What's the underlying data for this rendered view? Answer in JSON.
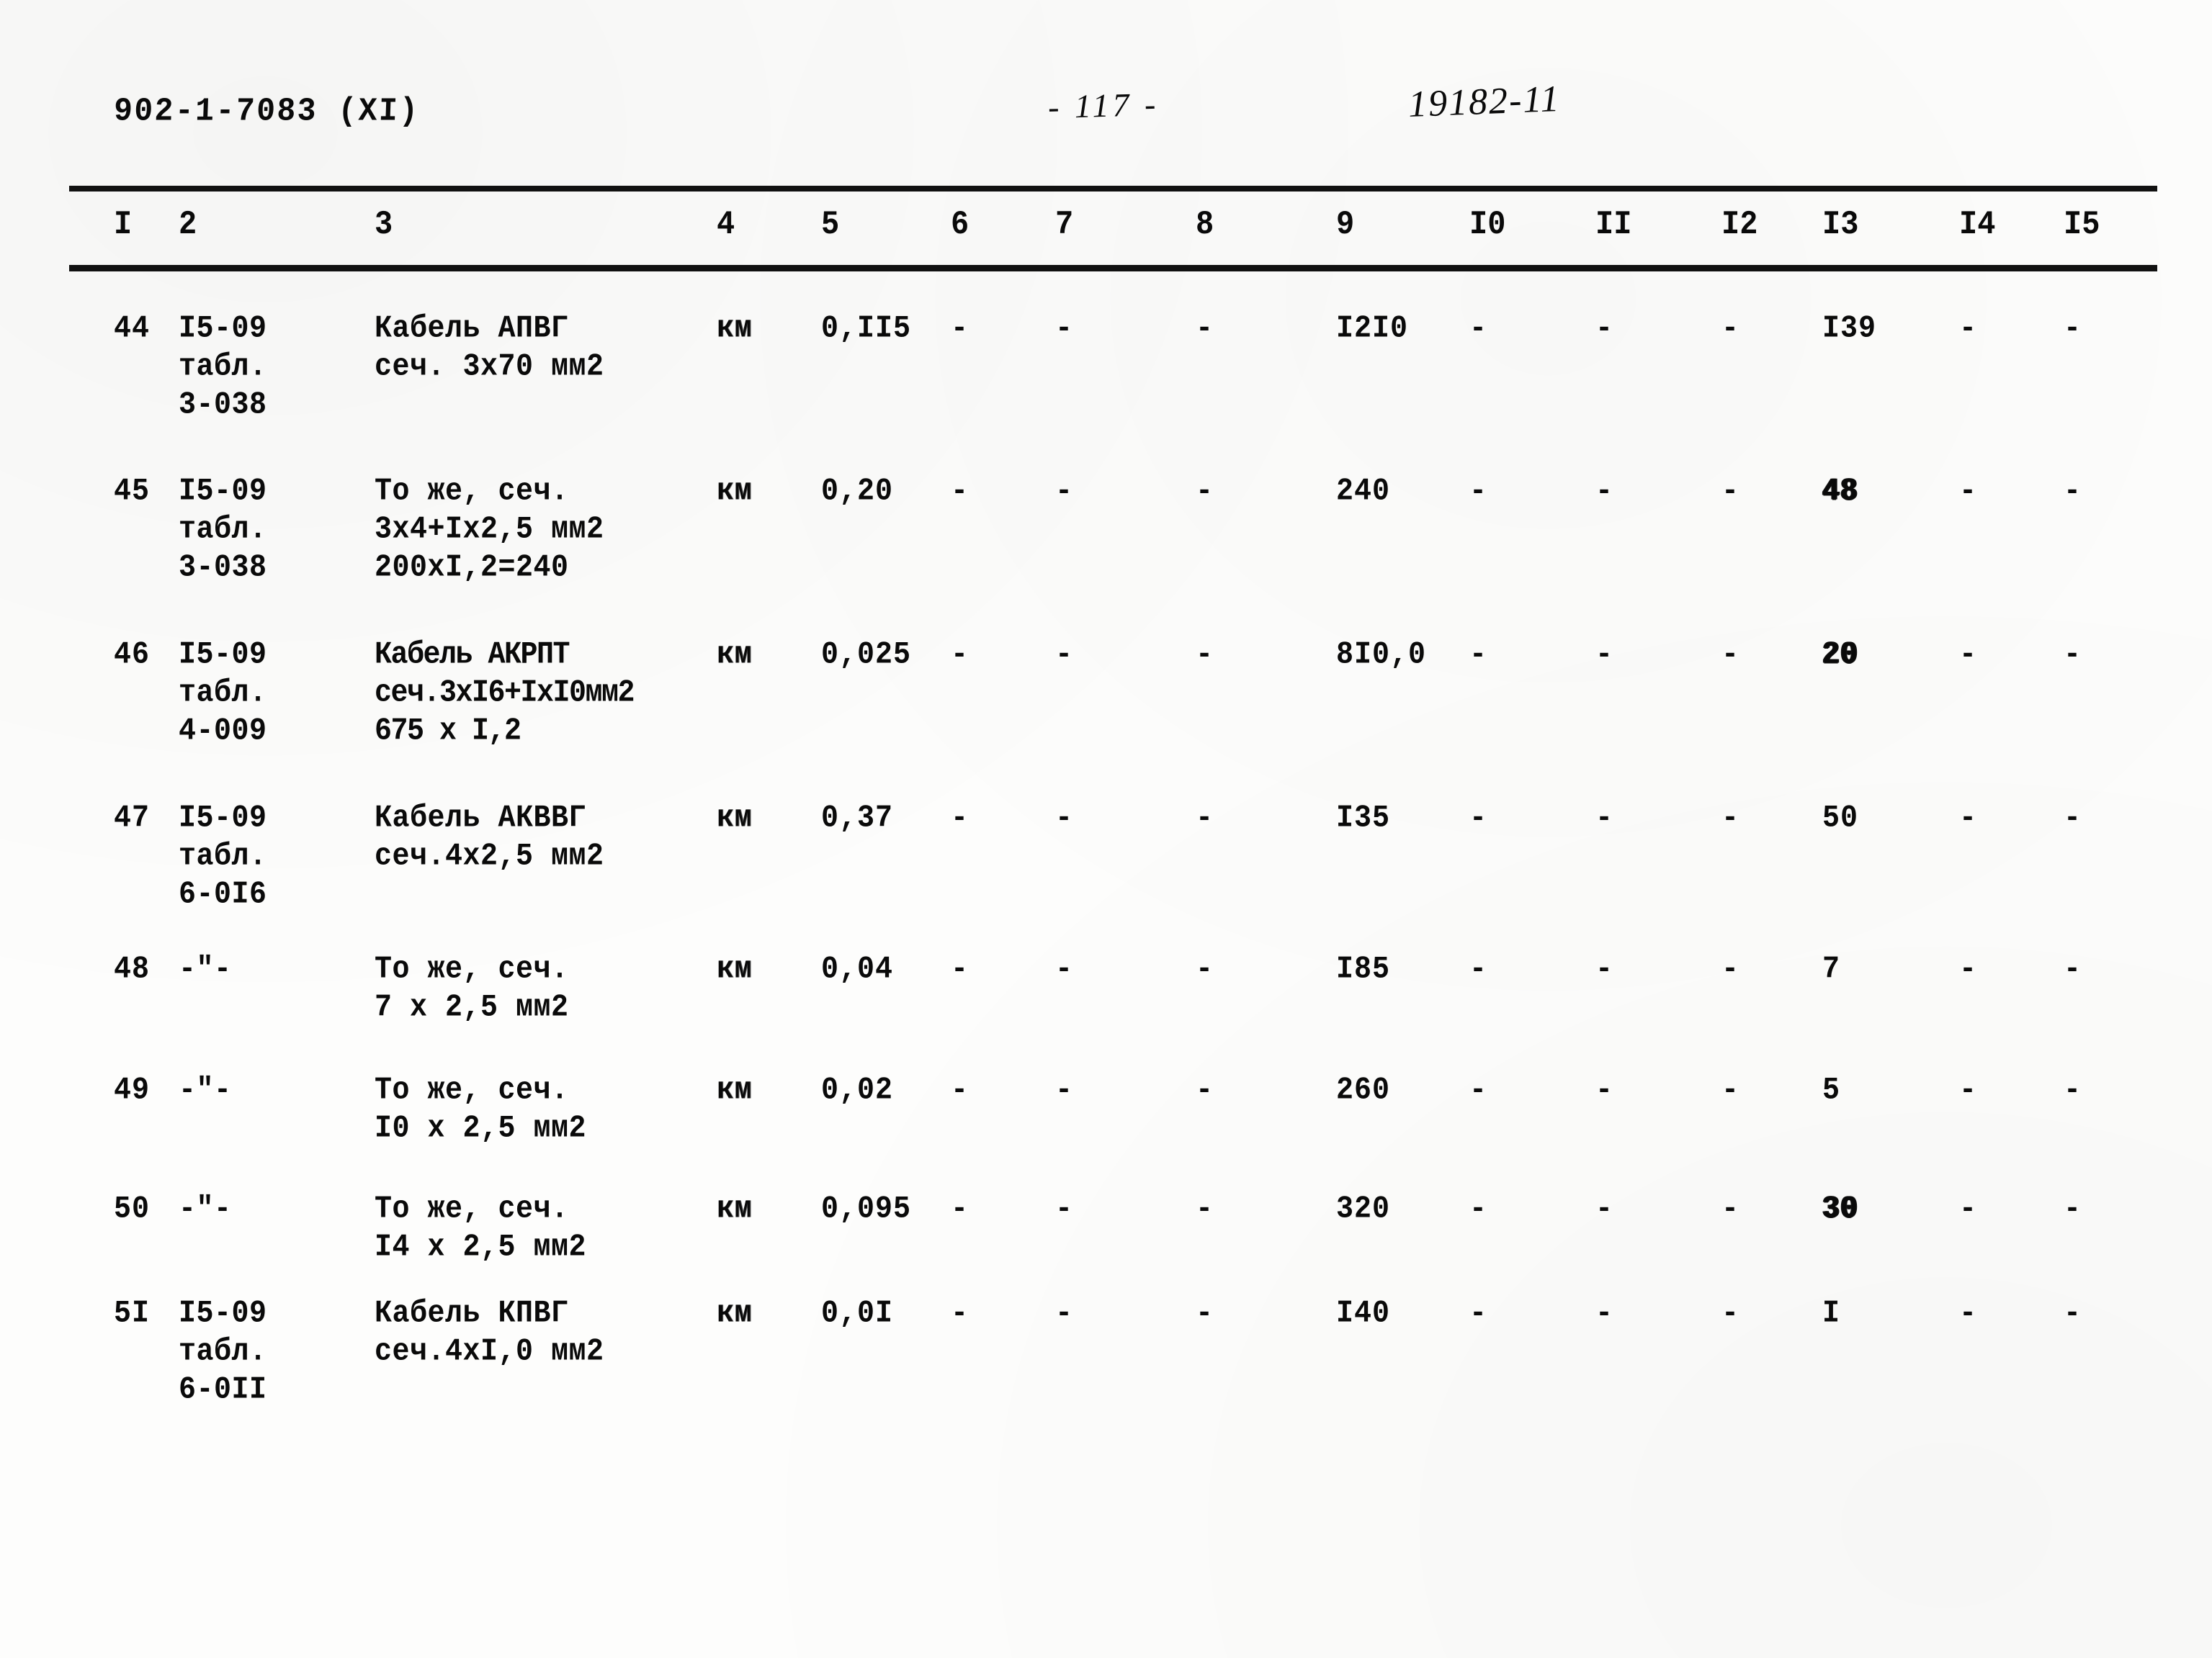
{
  "header": {
    "doc_code": "902-1-7083  (XI)",
    "page_number": "-  117  -",
    "stamp_number": "19182-11"
  },
  "table": {
    "column_headers": [
      "I",
      "2",
      "3",
      "4",
      "5",
      "6",
      "7",
      "8",
      "9",
      "I0",
      "II",
      "I2",
      "I3",
      "I4",
      "I5"
    ],
    "rows": [
      {
        "c1": "44",
        "c2": "I5-09\nтабл.\n3-038",
        "c3": "Кабель АПВГ\nсеч. 3х70 мм2",
        "c4": "км",
        "c5": "0,II5",
        "c6": "-",
        "c7": "-",
        "c8": "-",
        "c9": "I2I0",
        "c10": "-",
        "c11": "-",
        "c12": "-",
        "c13": "I39",
        "c14": "-",
        "c15": "-"
      },
      {
        "c1": "45",
        "c2": "I5-09\nтабл.\n3-038",
        "c3": "То же, сеч.\n3х4+Iх2,5 мм2\n200хI,2=240",
        "c4": "км",
        "c5": "0,20",
        "c6": "-",
        "c7": "-",
        "c8": "-",
        "c9": "240",
        "c10": "-",
        "c11": "-",
        "c12": "-",
        "c13": "48",
        "c14": "-",
        "c15": "-"
      },
      {
        "c1": "46",
        "c2": "I5-09\nтабл.\n4-009",
        "c3": "Кабель АКРПТ\nсеч.3хI6+IхI0мм2\n675 х I,2",
        "c4": "км",
        "c5": "0,025",
        "c6": "-",
        "c7": "-",
        "c8": "-",
        "c9": "8I0,0",
        "c10": "-",
        "c11": "-",
        "c12": "-",
        "c13": "20",
        "c14": "-",
        "c15": "-"
      },
      {
        "c1": "47",
        "c2": "I5-09\nтабл.\n6-0I6",
        "c3": "Кабель АКВВГ\nсеч.4х2,5 мм2",
        "c4": "км",
        "c5": "0,37",
        "c6": "-",
        "c7": "-",
        "c8": "-",
        "c9": "I35",
        "c10": "-",
        "c11": "-",
        "c12": "-",
        "c13": "50",
        "c14": "-",
        "c15": "-"
      },
      {
        "c1": "48",
        "c2": "-\"-",
        "c3": "То же, сеч.\n7 х 2,5 мм2",
        "c4": "км",
        "c5": "0,04",
        "c6": "-",
        "c7": "-",
        "c8": "-",
        "c9": "I85",
        "c10": "-",
        "c11": "-",
        "c12": "-",
        "c13": "7",
        "c14": "-",
        "c15": "-"
      },
      {
        "c1": "49",
        "c2": "-\"-",
        "c3": "То же, сеч.\nI0 х 2,5 мм2",
        "c4": "км",
        "c5": "0,02",
        "c6": "-",
        "c7": "-",
        "c8": "-",
        "c9": "260",
        "c10": "-",
        "c11": "-",
        "c12": "-",
        "c13": "5",
        "c14": "-",
        "c15": "-"
      },
      {
        "c1": "50",
        "c2": "-\"-",
        "c3": "То же, сеч.\nI4 х 2,5 мм2",
        "c4": "км",
        "c5": "0,095",
        "c6": "-",
        "c7": "-",
        "c8": "-",
        "c9": "320",
        "c10": "-",
        "c11": "-",
        "c12": "-",
        "c13": "30",
        "c14": "-",
        "c15": "-"
      },
      {
        "c1": "5I",
        "c2": "I5-09\nтабл.\n6-0II",
        "c3": "Кабель КПВГ\nсеч.4хI,0 мм2",
        "c4": "км",
        "c5": "0,0I",
        "c6": "-",
        "c7": "-",
        "c8": "-",
        "c9": "I40",
        "c10": "-",
        "c11": "-",
        "c12": "-",
        "c13": "I",
        "c14": "-",
        "c15": "-"
      }
    ]
  }
}
